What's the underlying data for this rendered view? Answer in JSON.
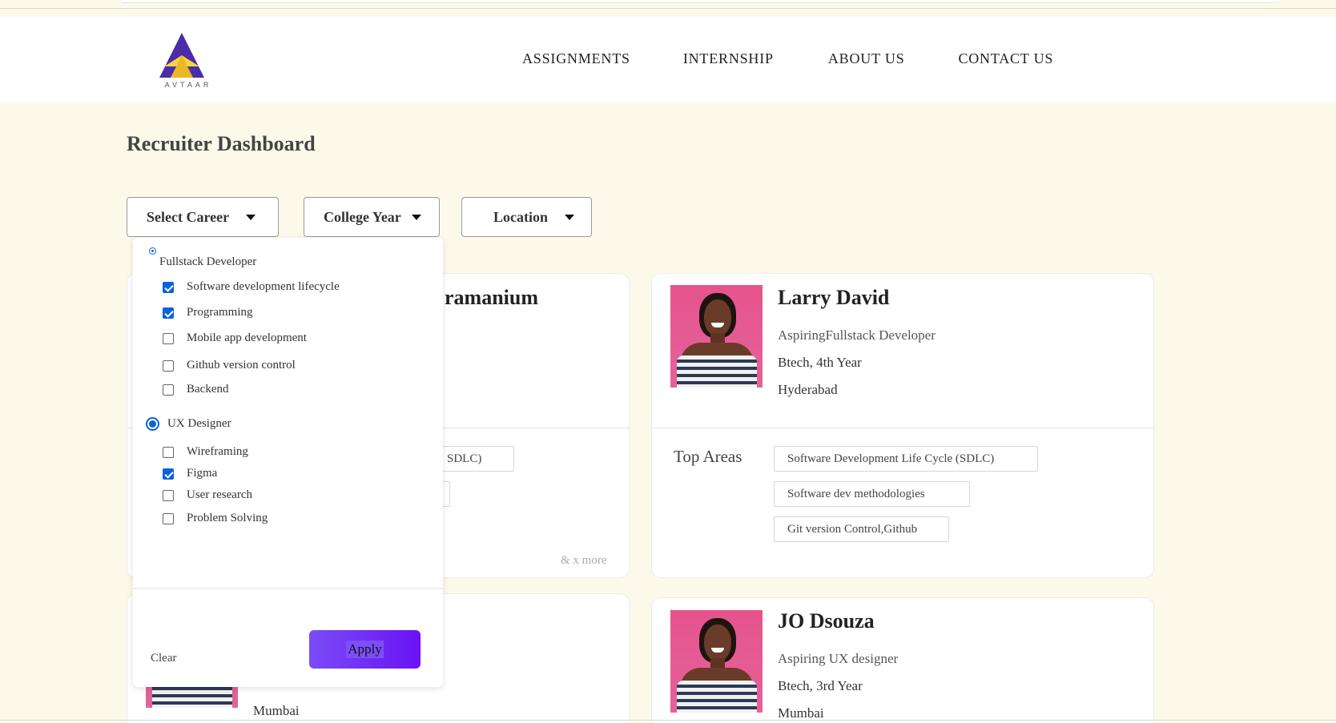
{
  "brand": {
    "logo_text": "AVTAAR"
  },
  "nav": [
    "ASSIGNMENTS",
    "INTERNSHIP",
    "ABOUT US",
    "CONTACT US"
  ],
  "page_title": "Recruiter Dashboard",
  "filters": {
    "career": "Select Career",
    "college_year": "College Year",
    "location": "Location"
  },
  "dropdown": {
    "group1": {
      "label": "Fullstack Developer",
      "selected": false,
      "items": [
        {
          "label": "Software development lifecycle",
          "checked": true
        },
        {
          "label": "Programming",
          "checked": true
        },
        {
          "label": "Mobile app development",
          "checked": false
        },
        {
          "label": "Github version control",
          "checked": false
        },
        {
          "label": "Backend",
          "checked": false
        }
      ]
    },
    "group2": {
      "label": "UX Designer",
      "selected": true,
      "items": [
        {
          "label": "Wireframing",
          "checked": false
        },
        {
          "label": "Figma",
          "checked": true
        },
        {
          "label": "User research",
          "checked": false
        },
        {
          "label": "Problem Solving",
          "checked": false
        }
      ]
    },
    "clear_label": "Clear",
    "apply_label": "Apply"
  },
  "cards": {
    "c1": {
      "name_fragment": "ramanium",
      "chip_fragment": "SDLC)",
      "more": "& x more"
    },
    "c2": {
      "name": "Larry David",
      "role": "AspiringFullstack Developer",
      "year": "Btech, 4th Year",
      "location": "Hyderabad",
      "top_areas_label": "Top Areas",
      "areas": [
        "Software Development Life Cycle (SDLC)",
        "Software dev methodologies",
        "Git version Control,Github"
      ]
    },
    "c3": {
      "location": "Mumbai"
    },
    "c4": {
      "name": "JO Dsouza",
      "role": "Aspiring UX designer",
      "year": "Btech, 3rd Year",
      "location": "Mumbai"
    }
  },
  "colors": {
    "accent": "#0b63d9",
    "apply_gradient_start": "#7a4cf7",
    "apply_gradient_end": "#6b12f3",
    "page_bg": "#fdf9ea"
  }
}
